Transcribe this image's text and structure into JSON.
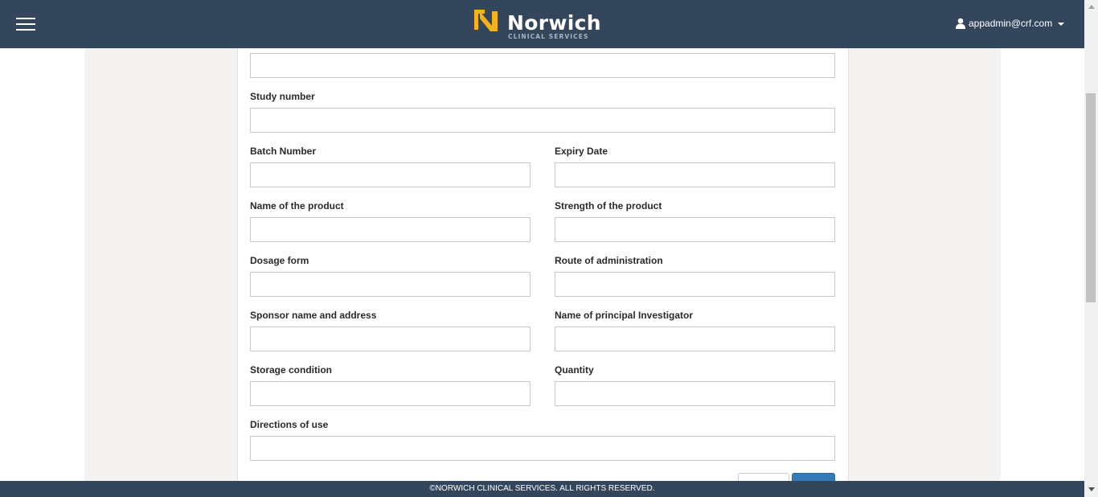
{
  "brand": {
    "name": "Norwich",
    "subtitle": "CLINICAL SERVICES",
    "accent": "#f5b21a"
  },
  "user": {
    "email": "appadmin@crf.com"
  },
  "form": {
    "study_number_label": "Study number",
    "batch_number_label": "Batch Number",
    "expiry_date_label": "Expiry Date",
    "product_name_label": "Name of the product",
    "product_strength_label": "Strength of the product",
    "dosage_form_label": "Dosage form",
    "route_label": "Route of administration",
    "sponsor_label": "Sponsor name and address",
    "investigator_label": "Name of principal Investigator",
    "storage_label": "Storage condition",
    "quantity_label": "Quantity",
    "directions_label": "Directions of use"
  },
  "footer": {
    "text": "©NORWICH CLINICAL SERVICES. ALL RIGHTS RESERVED."
  },
  "colors": {
    "navbar": "#34465c",
    "page_band": "#f5f3f2",
    "primary_button": "#337ab7"
  }
}
